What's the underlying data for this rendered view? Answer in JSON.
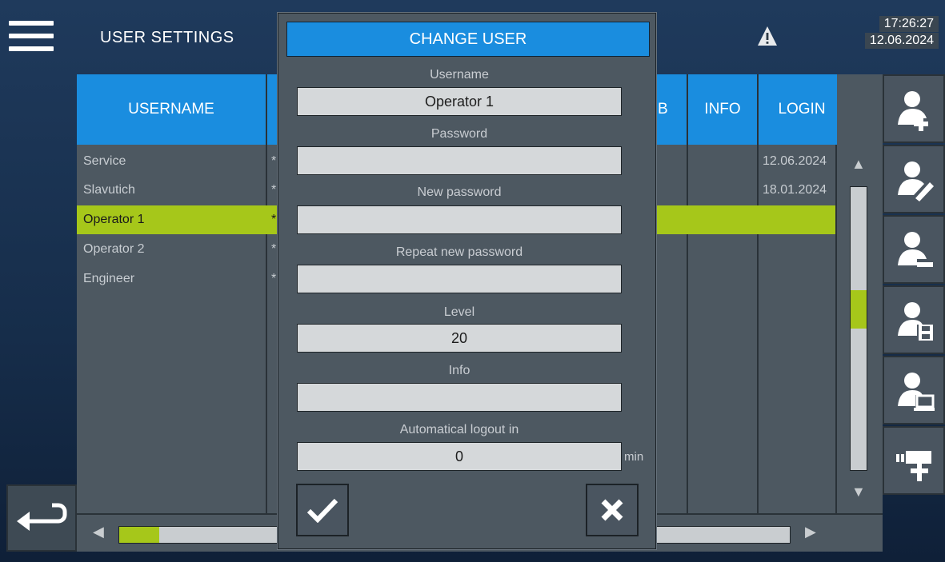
{
  "header": {
    "title": "USER SETTINGS",
    "time": "17:26:27",
    "date": "12.06.2024",
    "menu_icon": "hamburger-menu-icon",
    "alarm_icon": "warning-triangle-icon"
  },
  "table": {
    "columns": [
      {
        "label": "USERNAME"
      },
      {
        "label": ""
      },
      {
        "label": "B"
      },
      {
        "label": "INFO"
      },
      {
        "label": "LOGIN"
      }
    ],
    "rows": [
      {
        "username": "Service",
        "password": "*",
        "level": "",
        "info": "",
        "login": "12.06.2024",
        "selected": false
      },
      {
        "username": "Slavutich",
        "password": "*",
        "level": "",
        "info": "",
        "login": "18.01.2024",
        "selected": false
      },
      {
        "username": "Operator 1",
        "password": "*",
        "level": "",
        "info": "",
        "login": "",
        "selected": true
      },
      {
        "username": "Operator 2",
        "password": "*",
        "level": "",
        "info": "",
        "login": "",
        "selected": false
      },
      {
        "username": "Engineer",
        "password": "*",
        "level": "",
        "info": "",
        "login": "",
        "selected": false
      }
    ]
  },
  "vertical_scroll": {
    "up_arrow": "▲",
    "down_arrow": "▼",
    "position": 0.42
  },
  "horizontal_scroll": {
    "left_arrow": "◀",
    "right_arrow": "▶",
    "position": 0.0
  },
  "toolbar": [
    {
      "name": "add-user-button",
      "icon": "user-add-icon"
    },
    {
      "name": "edit-user-button",
      "icon": "user-edit-icon"
    },
    {
      "name": "remove-user-button",
      "icon": "user-remove-icon"
    },
    {
      "name": "save-user-button",
      "icon": "user-save-icon"
    },
    {
      "name": "user-logon-button",
      "icon": "user-computer-icon"
    },
    {
      "name": "add-device-button",
      "icon": "device-add-icon"
    }
  ],
  "dialog": {
    "title": "CHANGE USER",
    "fields": {
      "username": {
        "label": "Username",
        "value": "Operator 1"
      },
      "password": {
        "label": "Password",
        "value": ""
      },
      "new_password": {
        "label": "New password",
        "value": ""
      },
      "repeat_password": {
        "label": "Repeat new password",
        "value": ""
      },
      "level": {
        "label": "Level",
        "value": "20"
      },
      "info": {
        "label": "Info",
        "value": ""
      },
      "logout": {
        "label": "Automatical logout in",
        "value": "0",
        "unit": "min"
      }
    },
    "confirm_icon": "checkmark-icon",
    "cancel_icon": "close-icon"
  },
  "colors": {
    "accent_blue": "#1a8ddf",
    "selected_green": "#a6c71a",
    "panel_gray": "#4d5861"
  }
}
